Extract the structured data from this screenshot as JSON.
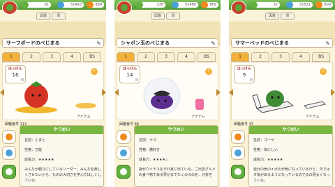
{
  "panels": [
    {
      "coins_green": "91",
      "coins_blue": "51493",
      "coins_orange": "809",
      "tab_left": "図鑑",
      "tab_right": "閉",
      "name": "サーフボードのべじまる",
      "tabs": [
        "1",
        "2",
        "3",
        "4",
        "BS"
      ],
      "active_tab": 0,
      "found_label": "はっけん",
      "found_count": "16",
      "found_unit": "回",
      "item_label": "アイテム",
      "dex_label": "図鑑番号",
      "dex_no": "113",
      "desc_title": "やつめい",
      "fields": [
        {
          "k": "名前",
          "v": "とまと"
        },
        {
          "k": "性格",
          "v": "万能"
        },
        {
          "k": "成長力",
          "v": "★★★★★"
        }
      ],
      "memo": "みんなが頼りにしているリーダー、みんなを楽しくさせたいから、ものの大切さを学んでほしくしている。"
    },
    {
      "coins_green": "239",
      "coins_blue": "51480",
      "coins_orange": "809",
      "tab_left": "図鑑",
      "tab_right": "閉",
      "name": "シャボン玉のべじまる",
      "tabs": [
        "1",
        "2",
        "3",
        "4",
        "BS"
      ],
      "active_tab": 0,
      "found_label": "はっけん",
      "found_count": "14",
      "found_unit": "回",
      "item_label": "アイテム",
      "dex_label": "図鑑番号",
      "dex_no": "88",
      "desc_title": "やつめい",
      "fields": [
        {
          "k": "名前",
          "v": "ナス"
        },
        {
          "k": "性格",
          "v": "勝好き"
        },
        {
          "k": "成長力",
          "v": "★★★★☆"
        }
      ],
      "memo": "夜がウイテスをそれ家に出ている。ご出吉グルメの食べ物である夢がまでたくみるのを、が好き"
    },
    {
      "coins_green": "32",
      "coins_blue": "51521",
      "coins_orange": "809",
      "tab_left": "図鑑",
      "tab_right": "閉",
      "name": "サマーベッドのべじまる",
      "tabs": [
        "1",
        "2",
        "3",
        "4",
        "BS"
      ],
      "active_tab": 0,
      "found_label": "はっけん",
      "found_count": "9",
      "found_unit": "回",
      "item_label": "アイテム",
      "dex_label": "図鑑番号",
      "dex_no": "33",
      "desc_title": "やつめい",
      "fields": [
        {
          "k": "名前",
          "v": "ゴーヤ"
        },
        {
          "k": "性格",
          "v": "気にしい"
        },
        {
          "k": "成長力",
          "v": "★★★★★"
        }
      ],
      "memo": "自分の気のイボのが気になっているけど、今ではダ気があるようになっているのでるの思女くなっている。"
    }
  ]
}
